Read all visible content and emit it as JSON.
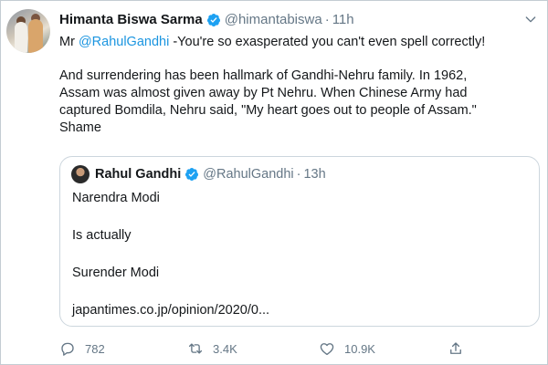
{
  "tweet": {
    "author_name": "Himanta Biswa Sarma",
    "handle": "@himantabiswa",
    "separator": "·",
    "time": "11h",
    "text_prefix": "Mr ",
    "mention": "@RahulGandhi",
    "text_line1_rest": " -You're so exasperated you can't even spell correctly!",
    "paragraph2": [
      "And surrendering has been hallmark of  Gandhi-Nehru family. In 1962,",
      "Assam was almost given away by Pt Nehru. When Chinese Army had",
      "captured Bomdila, Nehru said, \"My heart goes out to people of Assam.\"",
      "Shame"
    ]
  },
  "quoted": {
    "author_name": "Rahul Gandhi",
    "handle": "@RahulGandhi",
    "separator": "·",
    "time": "13h",
    "lines": [
      "Narendra Modi",
      "Is actually",
      "Surender Modi",
      "japantimes.co.jp/opinion/2020/0..."
    ]
  },
  "actions": {
    "reply_count": "782",
    "retweet_count": "3.4K",
    "like_count": "10.9K"
  },
  "icons": {
    "verified": "verified-badge-icon",
    "more": "chevron-down-icon",
    "reply": "reply-icon",
    "retweet": "retweet-icon",
    "like": "heart-icon",
    "share": "share-icon"
  },
  "colors": {
    "link": "#1b95e0",
    "verified": "#1da1f2",
    "muted": "#657786",
    "border": "#ccd6dd"
  }
}
